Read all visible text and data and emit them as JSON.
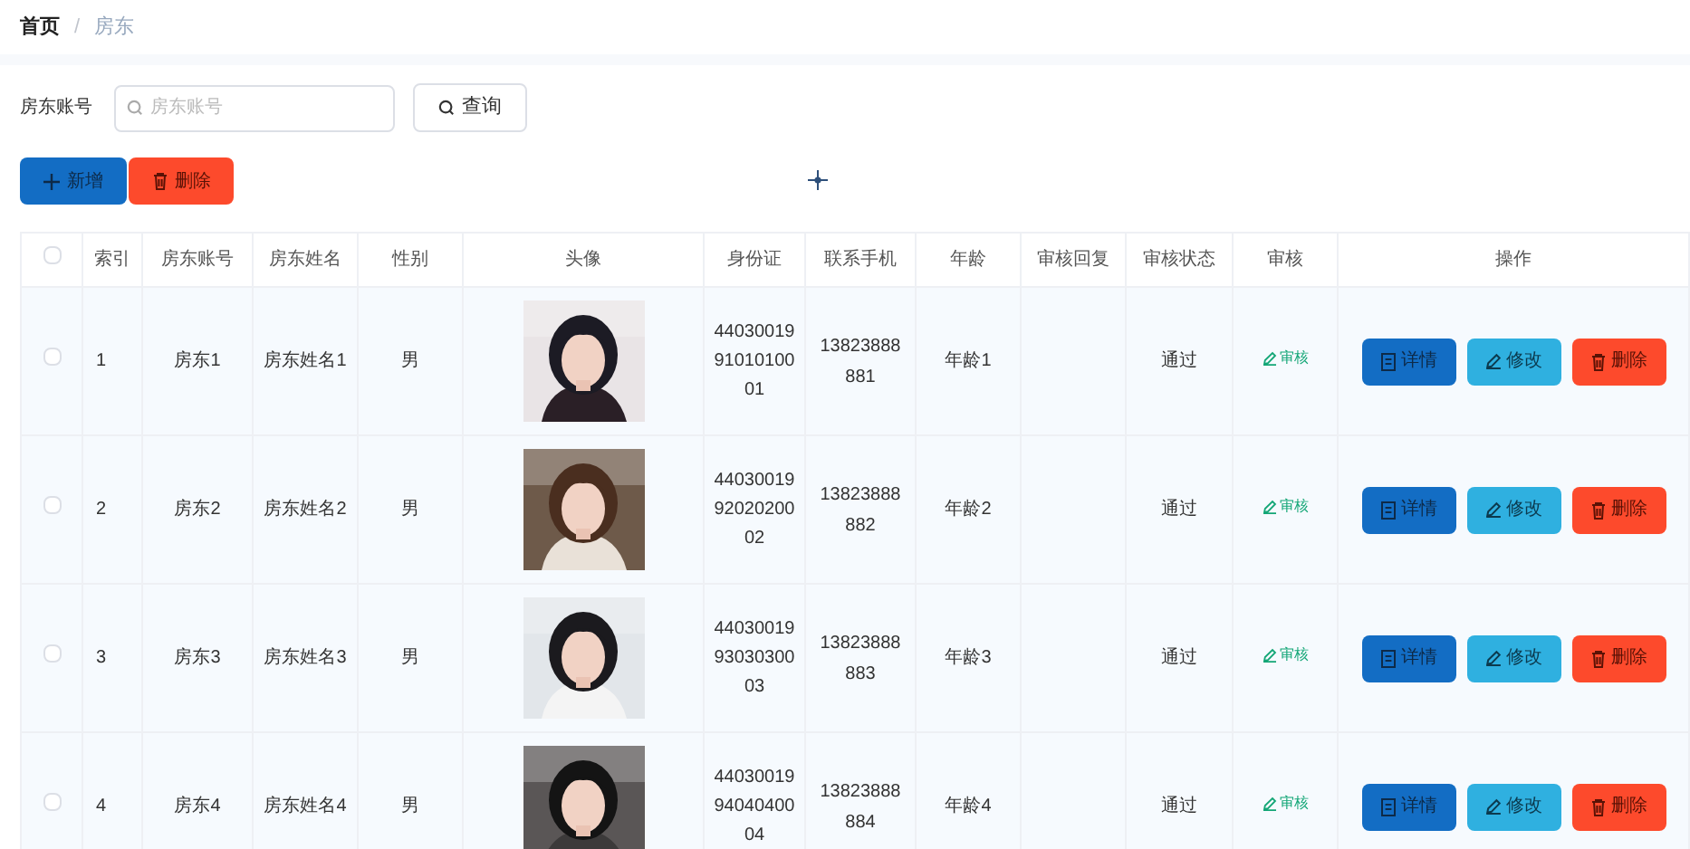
{
  "breadcrumb": [
    {
      "label": "首页",
      "current": false
    },
    {
      "label": "/",
      "current": false
    },
    {
      "label": "房东",
      "current": true
    }
  ],
  "search": {
    "label": "房东账号",
    "placeholder": "房东账号",
    "button": "查询"
  },
  "toolbar": {
    "add": "新增",
    "delete": "删除"
  },
  "table": {
    "select_all": {
      "checked": false
    },
    "columns": [
      "索引",
      "房东账号",
      "房东姓名",
      "性别",
      "头像",
      "身份证",
      "联系手机",
      "年龄",
      "审核回复",
      "审核状态",
      "审核",
      "操作"
    ],
    "rows": [
      {
        "selected": false,
        "index": "1",
        "account": "房东1",
        "name": "房东姓名1",
        "gender": "男",
        "avatar": {
          "kind": "picture"
        },
        "id_card": "440300199101010001",
        "phone": "13823888881",
        "age": "年龄1",
        "status": "通过",
        "audit": "审核",
        "actions": [
          "详情",
          "修改",
          "删除"
        ]
      },
      {
        "selected": false,
        "index": "2",
        "account": "房东2",
        "name": "房东姓名2",
        "gender": "男",
        "avatar": {
          "kind": "picture"
        },
        "id_card": "440300199202020002",
        "phone": "13823888882",
        "age": "年龄2",
        "status": "通过",
        "audit": "审核",
        "actions": [
          "详情",
          "修改",
          "删除"
        ]
      },
      {
        "selected": false,
        "index": "3",
        "account": "房东3",
        "name": "房东姓名3",
        "gender": "男",
        "avatar": {
          "kind": "picture"
        },
        "id_card": "440300199303030003",
        "phone": "13823888883",
        "age": "年龄3",
        "status": "通过",
        "audit": "审核",
        "actions": [
          "详情",
          "修改",
          "删除"
        ]
      },
      {
        "selected": false,
        "index": "4",
        "account": "房东4",
        "name": "房东姓名4",
        "gender": "男",
        "avatar": {
          "kind": "picture"
        },
        "id_card": "440300199404040004",
        "phone": "13823888884",
        "age": "年龄4",
        "status": "通过",
        "audit": "审核",
        "actions": [
          "详情",
          "修改",
          "删除"
        ]
      }
    ]
  }
}
